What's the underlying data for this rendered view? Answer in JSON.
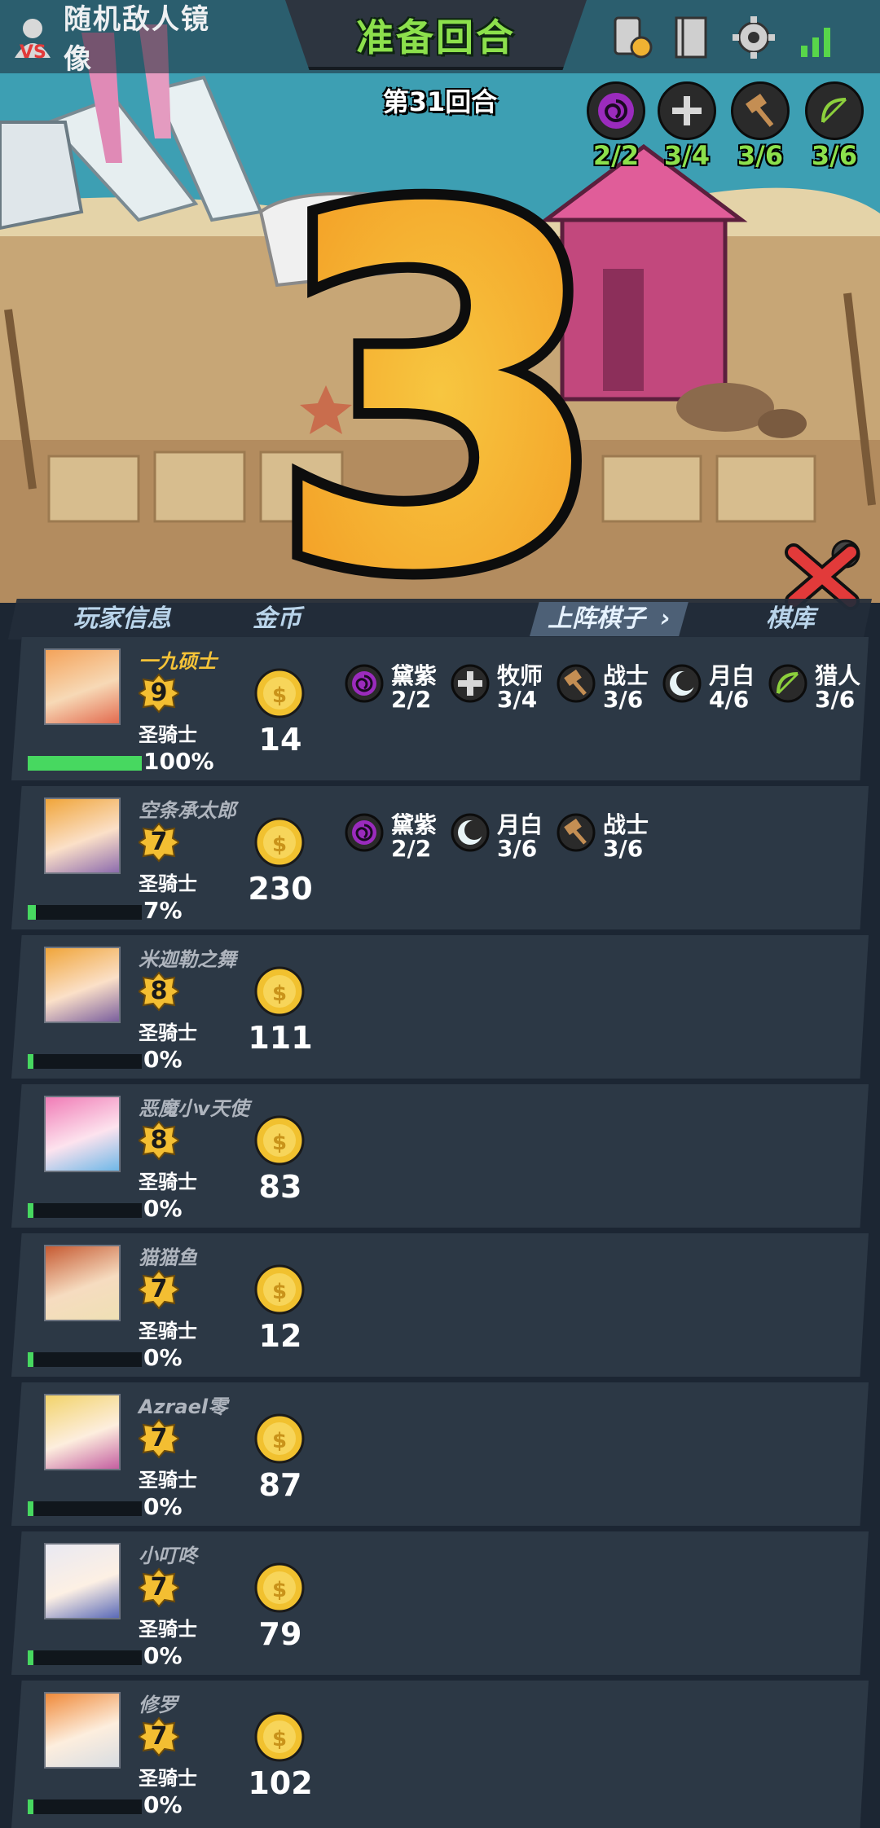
{
  "header": {
    "mirror_label": "随机敌人镜像",
    "round_title": "准备回合",
    "round_number": "第31回合"
  },
  "countdown": "3",
  "top_synergies": [
    {
      "count": "2/2",
      "color": "#9b2bbd",
      "icon": "spiral-icon"
    },
    {
      "count": "3/4",
      "color": "#d8d8d8",
      "icon": "cross-shield-icon"
    },
    {
      "count": "3/6",
      "color": "#c48e53",
      "icon": "hammer-icon"
    },
    {
      "count": "3/6",
      "color": "#8ccf3c",
      "icon": "bow-icon"
    }
  ],
  "tabs": {
    "player_info": "玩家信息",
    "gold": "金币",
    "deployed": "上阵棋子",
    "bench": "棋库"
  },
  "players": [
    {
      "name": "一九硕士",
      "level": "9",
      "rank": "圣骑士",
      "progress": "100%",
      "progress_value": 1.0,
      "gold": "14",
      "me": true,
      "synergies": [
        {
          "name": "黛紫",
          "count": "2/2",
          "icon": "spiral-icon"
        },
        {
          "name": "牧师",
          "count": "3/4",
          "icon": "cross-shield-icon"
        },
        {
          "name": "战士",
          "count": "3/6",
          "icon": "hammer-icon"
        },
        {
          "name": "月白",
          "count": "4/6",
          "icon": "moon-icon"
        },
        {
          "name": "猎人",
          "count": "3/6",
          "icon": "bow-icon"
        }
      ]
    },
    {
      "name": "空条承太郎",
      "level": "7",
      "rank": "圣骑士",
      "progress": "7%",
      "progress_value": 0.07,
      "gold": "230",
      "me": false,
      "synergies": [
        {
          "name": "黛紫",
          "count": "2/2",
          "icon": "spiral-icon"
        },
        {
          "name": "月白",
          "count": "3/6",
          "icon": "moon-icon"
        },
        {
          "name": "战士",
          "count": "3/6",
          "icon": "hammer-icon"
        }
      ]
    },
    {
      "name": "米迦勒之舞",
      "level": "8",
      "rank": "圣骑士",
      "progress": "0%",
      "progress_value": 0.0,
      "gold": "111",
      "me": false,
      "synergies": []
    },
    {
      "name": "恶魔小v天使",
      "level": "8",
      "rank": "圣骑士",
      "progress": "0%",
      "progress_value": 0.0,
      "gold": "83",
      "me": false,
      "synergies": []
    },
    {
      "name": "猫猫鱼",
      "level": "7",
      "rank": "圣骑士",
      "progress": "0%",
      "progress_value": 0.0,
      "gold": "12",
      "me": false,
      "synergies": []
    },
    {
      "name": "Azrael零",
      "level": "7",
      "rank": "圣骑士",
      "progress": "0%",
      "progress_value": 0.0,
      "gold": "87",
      "me": false,
      "synergies": []
    },
    {
      "name": "小叮咚",
      "level": "7",
      "rank": "圣骑士",
      "progress": "0%",
      "progress_value": 0.0,
      "gold": "79",
      "me": false,
      "synergies": []
    },
    {
      "name": "修罗",
      "level": "7",
      "rank": "圣骑士",
      "progress": "0%",
      "progress_value": 0.0,
      "gold": "102",
      "me": false,
      "synergies": []
    }
  ]
}
